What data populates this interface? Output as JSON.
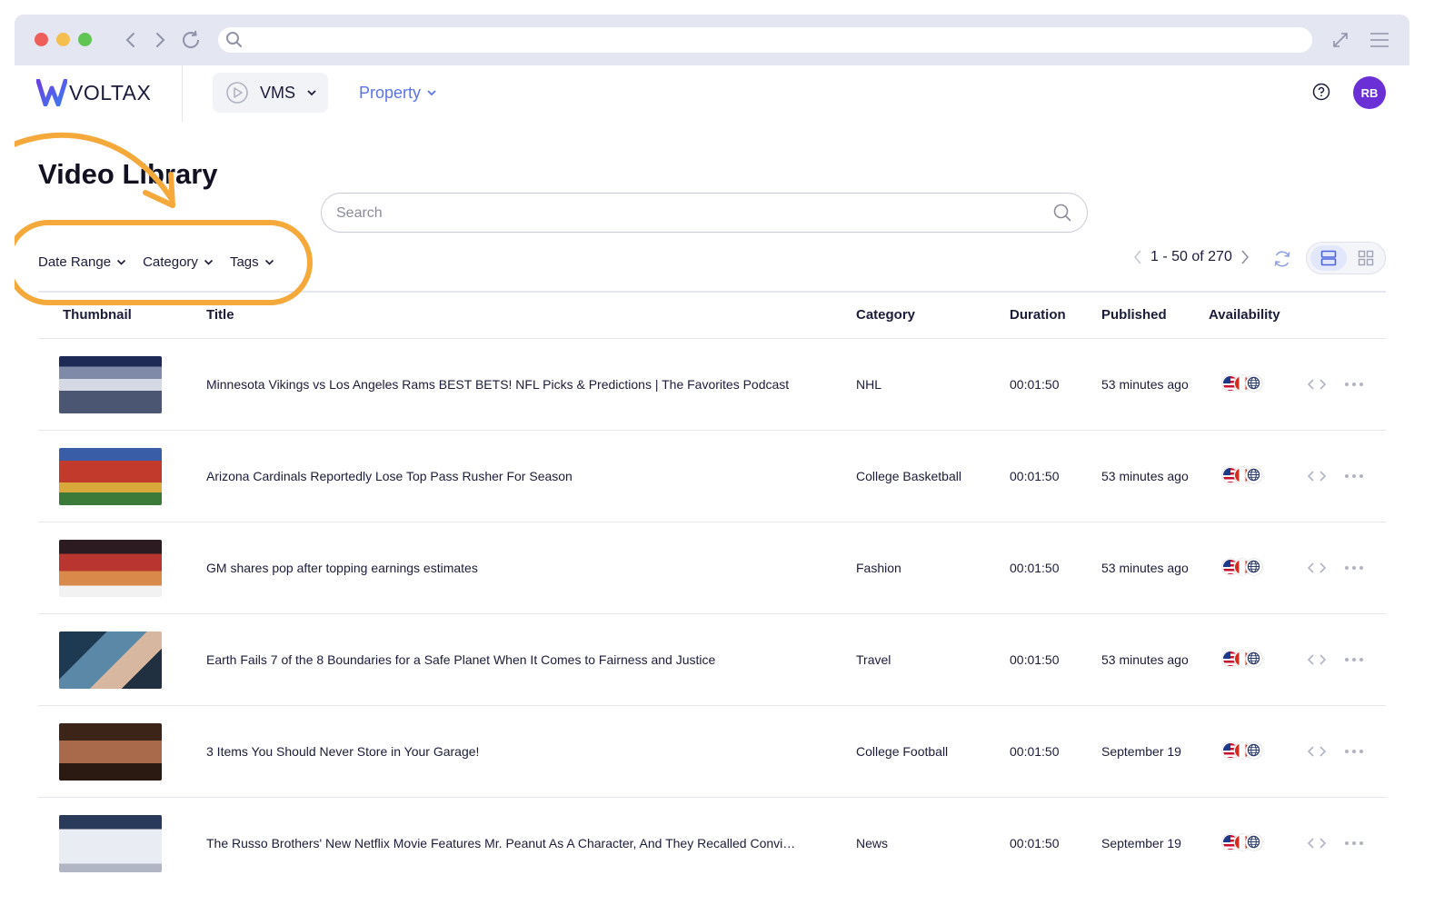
{
  "browser": {
    "icons": [
      "back-icon",
      "forward-icon",
      "reload-icon",
      "search-icon",
      "expand-icon",
      "menu-icon"
    ]
  },
  "header": {
    "logo_text": "VOLTAX",
    "product_label": "VMS",
    "property_label": "Property",
    "avatar_initials": "RB",
    "accent_color": "#5b73e8",
    "avatar_color": "#6b2fd6"
  },
  "page": {
    "title": "Video Library",
    "search_placeholder": "Search",
    "filters": [
      "Date Range",
      "Category",
      "Tags"
    ],
    "pagination": "1 - 50 of 270",
    "highlight_color": "#f5a93a"
  },
  "table": {
    "columns": [
      "Thumbnail",
      "Title",
      "Category",
      "Duration",
      "Published",
      "Availability"
    ],
    "rows": [
      {
        "title": "Minnesota Vikings vs Los Angeles Rams BEST BETS! NFL Picks & Predictions | The Favorites Podcast",
        "category": "NHL",
        "duration": "00:01:50",
        "published": "53 minutes ago"
      },
      {
        "title": "Arizona Cardinals Reportedly Lose Top Pass Rusher For Season",
        "category": "College Basketball",
        "duration": "00:01:50",
        "published": "53 minutes ago"
      },
      {
        "title": "GM shares pop after topping earnings estimates",
        "category": "Fashion",
        "duration": "00:01:50",
        "published": "53 minutes ago"
      },
      {
        "title": "Earth Fails 7 of the 8 Boundaries for a Safe Planet When It Comes to Fairness and Justice",
        "category": "Travel",
        "duration": "00:01:50",
        "published": "53 minutes ago"
      },
      {
        "title": "3 Items You Should Never Store in Your Garage!",
        "category": "College Football",
        "duration": "00:01:50",
        "published": "September 19"
      },
      {
        "title": "The Russo Brothers' New Netflix Movie Features Mr. Peanut As A Character, And They Recalled Convinc...",
        "category": "News",
        "duration": "00:01:50",
        "published": "September 19"
      }
    ]
  }
}
